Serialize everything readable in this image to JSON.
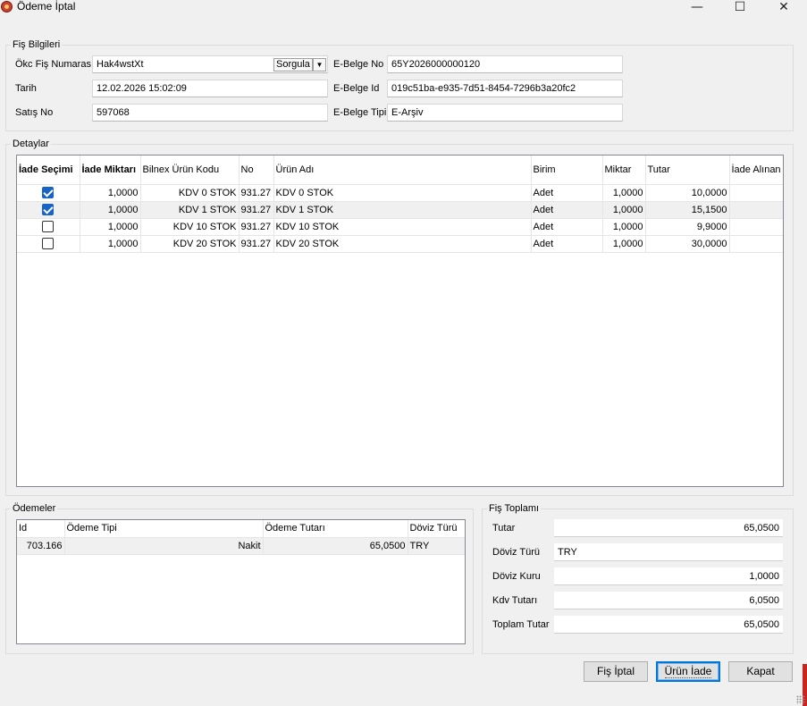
{
  "window": {
    "title": "Ödeme İptal",
    "minimize": "—",
    "maximize": "☐",
    "close": "✕"
  },
  "fis_bilgileri": {
    "legend": "Fiş Bilgileri",
    "okc_label": "Ökc Fiş Numarası",
    "okc_value": "Hak4wstXt",
    "sorgula_label": "Sorgula",
    "tarih_label": "Tarih",
    "tarih_value": "12.02.2026 15:02:09",
    "satis_label": "Satış No",
    "satis_value": "597068",
    "ebelge_no_label": "E-Belge No",
    "ebelge_no_value": "65Y2026000000120",
    "ebelge_id_label": "E-Belge Id",
    "ebelge_id_value": "019c51ba-e935-7d51-8454-7296b3a20fc2",
    "ebelge_tipi_label": "E-Belge Tipi",
    "ebelge_tipi_value": "E-Arşiv"
  },
  "detaylar": {
    "legend": "Detaylar",
    "columns": [
      "İade Seçimi",
      "İade Miktarı",
      "Bilnex Ürün Kodu",
      "No",
      "Ürün Adı",
      "Birim",
      "Miktar",
      "Tutar",
      "İade Alınan"
    ],
    "rows": [
      {
        "checked": true,
        "iade_miktari": "1,0000",
        "urun_kodu": "KDV 0 STOK",
        "no": "931.27",
        "urun_adi": "KDV 0 STOK",
        "birim": "Adet",
        "miktar": "1,0000",
        "tutar": "10,0000",
        "iade_alinan": ""
      },
      {
        "checked": true,
        "iade_miktari": "1,0000",
        "urun_kodu": "KDV 1 STOK",
        "no": "931.27",
        "urun_adi": "KDV 1 STOK",
        "birim": "Adet",
        "miktar": "1,0000",
        "tutar": "15,1500",
        "iade_alinan": ""
      },
      {
        "checked": false,
        "iade_miktari": "1,0000",
        "urun_kodu": "KDV 10 STOK",
        "no": "931.27",
        "urun_adi": "KDV 10 STOK",
        "birim": "Adet",
        "miktar": "1,0000",
        "tutar": "9,9000",
        "iade_alinan": ""
      },
      {
        "checked": false,
        "iade_miktari": "1,0000",
        "urun_kodu": "KDV 20 STOK",
        "no": "931.27",
        "urun_adi": "KDV 20 STOK",
        "birim": "Adet",
        "miktar": "1,0000",
        "tutar": "30,0000",
        "iade_alinan": ""
      }
    ]
  },
  "odemeler": {
    "legend": "Ödemeler",
    "columns": [
      "Id",
      "Ödeme Tipi",
      "Ödeme Tutarı",
      "Döviz Türü"
    ],
    "rows": [
      {
        "id": "703.166",
        "tip": "Nakit",
        "tutar": "65,0500",
        "doviz": "TRY"
      }
    ]
  },
  "fis_toplami": {
    "legend": "Fiş Toplamı",
    "tutar_label": "Tutar",
    "tutar_value": "65,0500",
    "doviz_turu_label": "Döviz Türü",
    "doviz_turu_value": "TRY",
    "doviz_kuru_label": "Döviz Kuru",
    "doviz_kuru_value": "1,0000",
    "kdv_label": "Kdv Tutarı",
    "kdv_value": "6,0500",
    "toplam_label": "Toplam Tutar",
    "toplam_value": "65,0500"
  },
  "buttons": {
    "fis_iptal": "Fiş İptal",
    "urun_iade": "Ürün İade",
    "kapat": "Kapat"
  },
  "colors": {
    "accent": "#0078d7",
    "checkbox": "#1763c6",
    "app_icon": "#c8422e"
  }
}
